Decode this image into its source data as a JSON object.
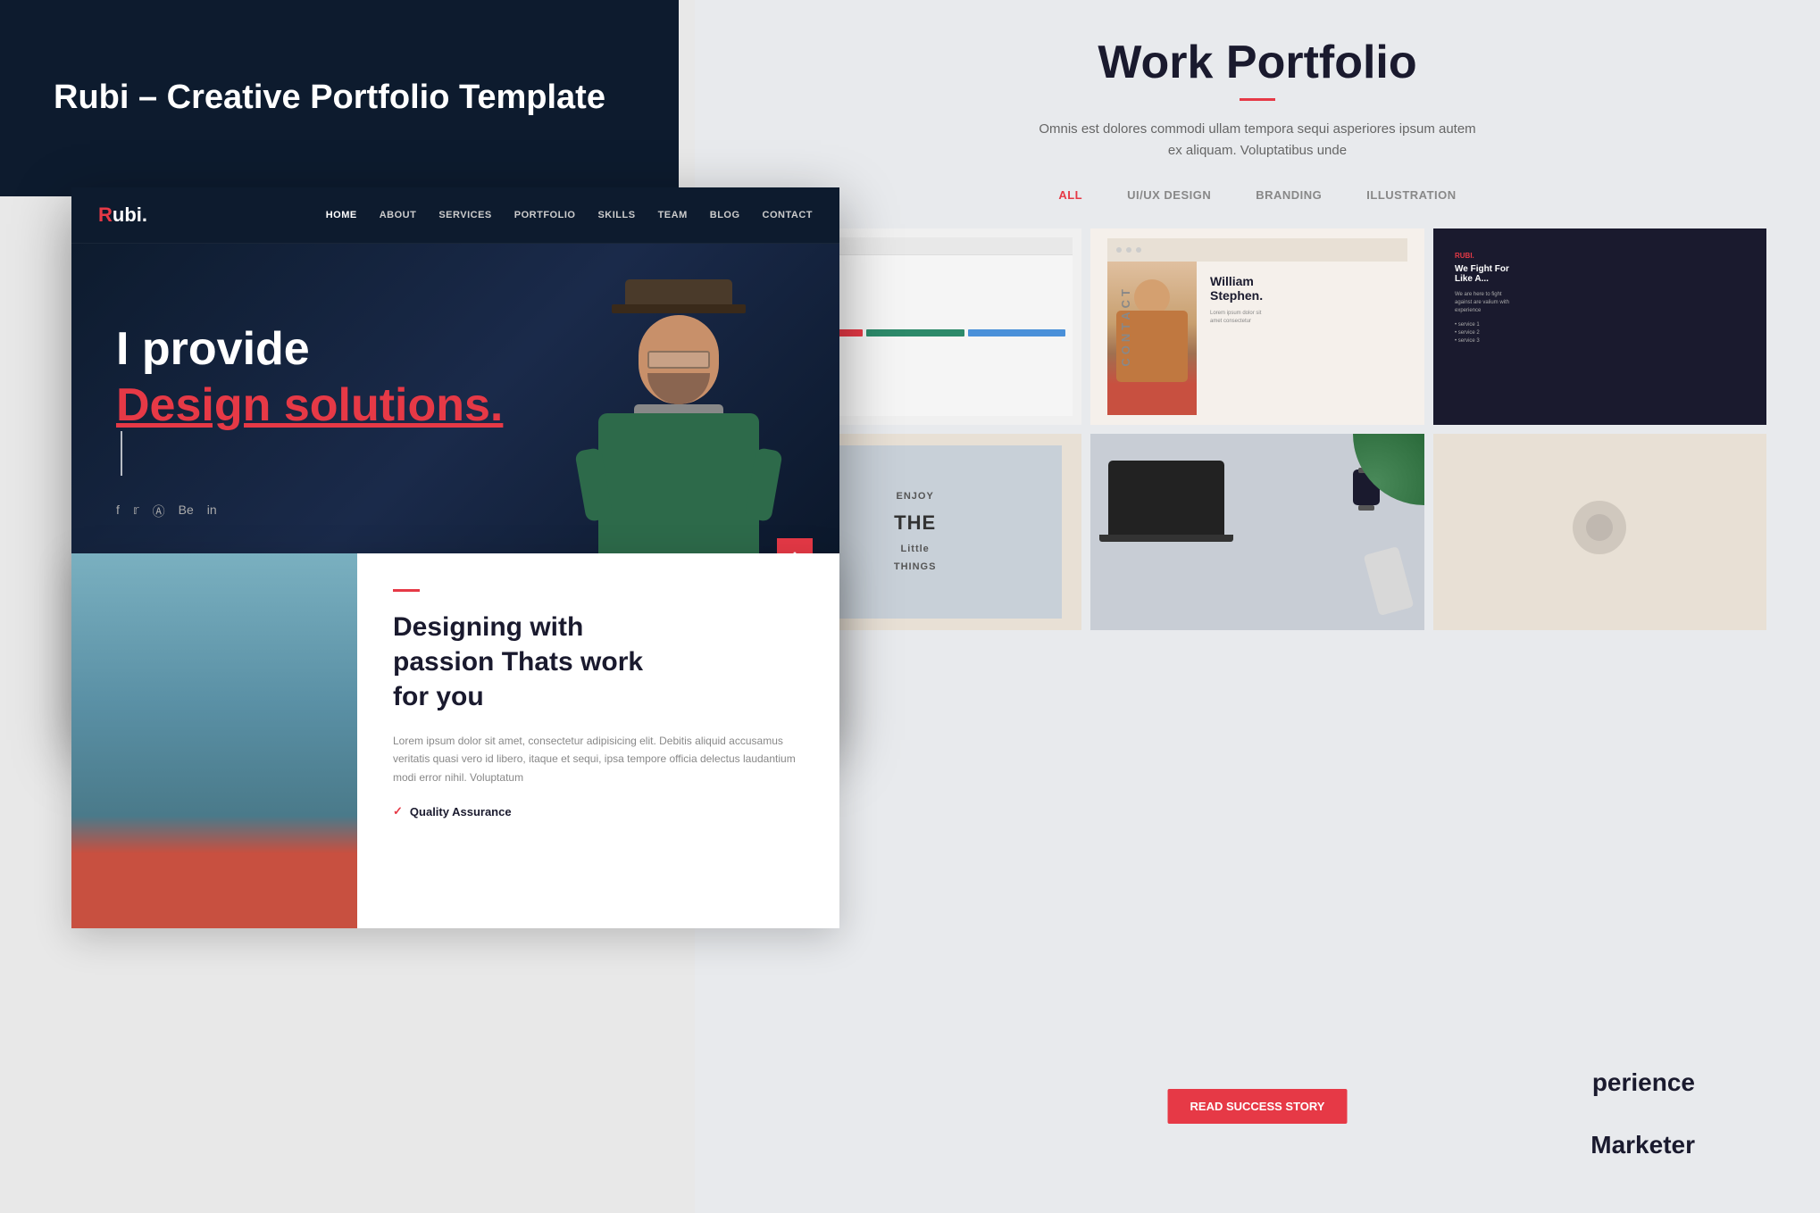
{
  "header": {
    "title": "Rubi – Creative Portfolio Template",
    "background_color": "#0d1b2e"
  },
  "right_panel": {
    "title": "Work Portfolio",
    "subtitle": "Omnis est dolores commodi ullam tempora sequi asperiores ipsum autem ex aliquam. Voluptatibus unde",
    "filters": [
      "ALL",
      "UI/UX DESIGN",
      "BRANDING",
      "ILLUSTRATION"
    ],
    "active_filter": "ALL",
    "read_success_label": "READ SUCCESS STORY"
  },
  "website_mockup": {
    "nav": {
      "logo": "Rubi.",
      "logo_r": "R",
      "links": [
        "HOME",
        "ABOUT",
        "SERVICES",
        "PORTFOLIO",
        "SKILLS",
        "TEAM",
        "BLOG",
        "CONTACT"
      ]
    },
    "hero": {
      "line1": "I provide",
      "line2": "Design solutions.",
      "social_icons": [
        "f",
        "t",
        "d",
        "be",
        "in"
      ]
    }
  },
  "about_section": {
    "heading_line1": "Designing with",
    "heading_line2": "passion Thats work",
    "heading_line3": "for you",
    "body_text": "Lorem ipsum dolor sit amet, consectetur adipisicing elit. Debitis aliquid accusamus veritatis quasi vero id libero, itaque et sequi, ipsa tempore officia delectus laudantium modi error nihil. Voluptatum",
    "check_item": "Quality Assurance"
  },
  "contact_vertical": "CONTACT",
  "bottom_labels": {
    "experience": "perience",
    "marketer": "Marketer"
  },
  "person_card": {
    "name_line1": "William",
    "name_line2": "Stephen."
  }
}
